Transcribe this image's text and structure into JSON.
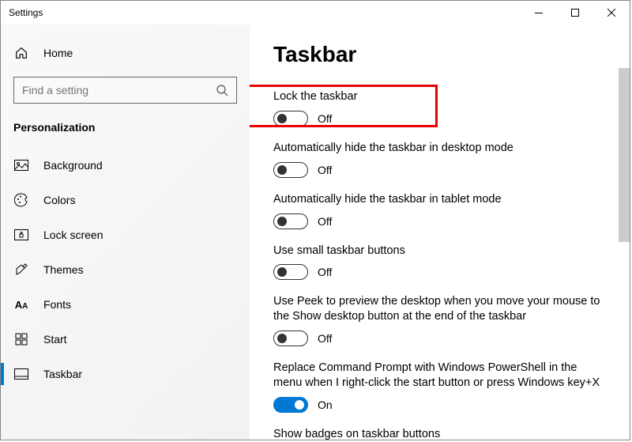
{
  "window": {
    "title": "Settings"
  },
  "sidebar": {
    "home": "Home",
    "search_placeholder": "Find a setting",
    "category": "Personalization",
    "items": [
      {
        "label": "Background"
      },
      {
        "label": "Colors"
      },
      {
        "label": "Lock screen"
      },
      {
        "label": "Themes"
      },
      {
        "label": "Fonts"
      },
      {
        "label": "Start"
      },
      {
        "label": "Taskbar"
      }
    ]
  },
  "main": {
    "title": "Taskbar",
    "settings": [
      {
        "label": "Lock the taskbar",
        "state": "Off",
        "on": false
      },
      {
        "label": "Automatically hide the taskbar in desktop mode",
        "state": "Off",
        "on": false
      },
      {
        "label": "Automatically hide the taskbar in tablet mode",
        "state": "Off",
        "on": false
      },
      {
        "label": "Use small taskbar buttons",
        "state": "Off",
        "on": false
      },
      {
        "label": "Use Peek to preview the desktop when you move your mouse to the Show desktop button at the end of the taskbar",
        "state": "Off",
        "on": false
      },
      {
        "label": "Replace Command Prompt with Windows PowerShell in the menu when I right-click the start button or press Windows key+X",
        "state": "On",
        "on": true
      },
      {
        "label": "Show badges on taskbar buttons",
        "state": "",
        "on": false
      }
    ]
  }
}
